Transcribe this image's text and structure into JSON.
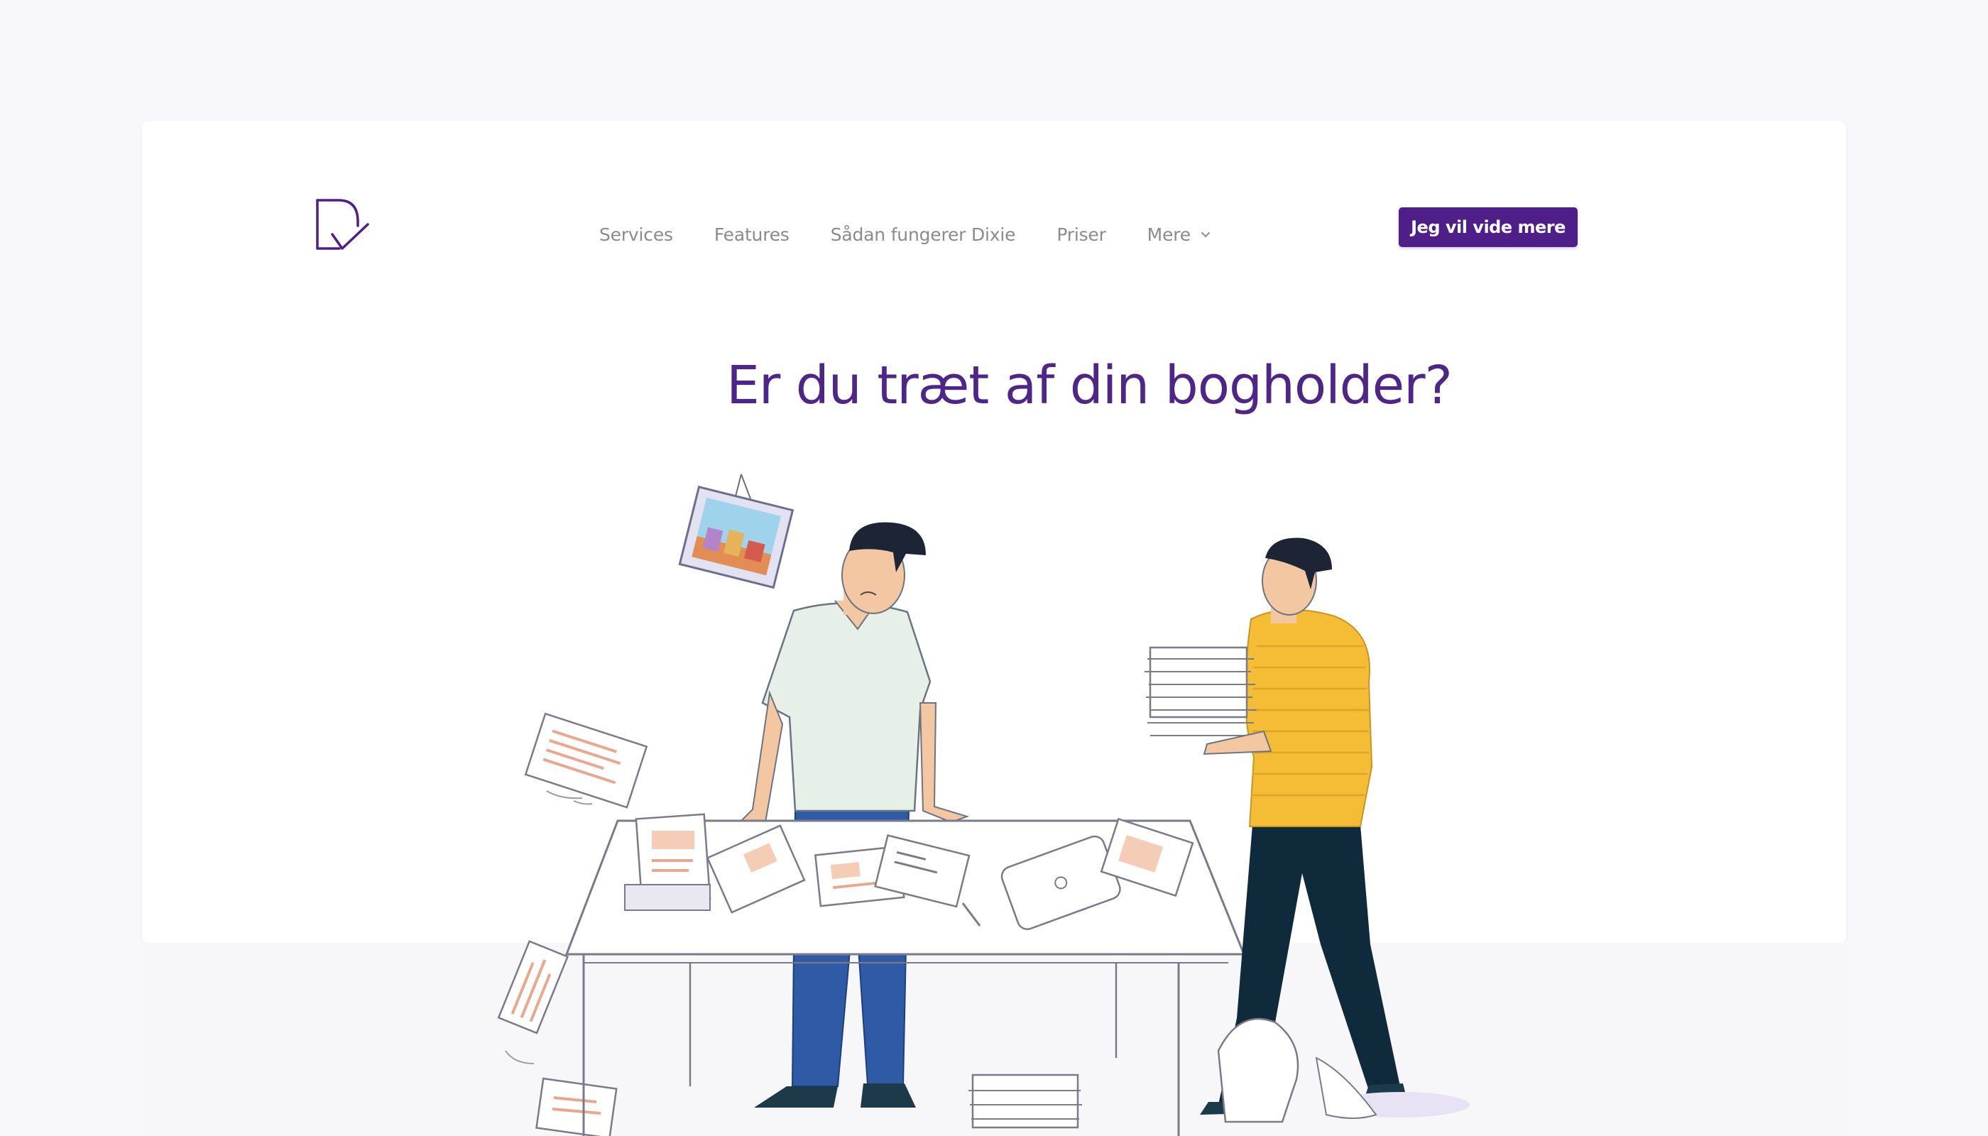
{
  "nav": {
    "items": [
      {
        "label": "Services"
      },
      {
        "label": "Features"
      },
      {
        "label": "Sådan fungerer Dixie"
      },
      {
        "label": "Priser"
      },
      {
        "label": "Mere"
      }
    ]
  },
  "cta": {
    "label": "Jeg vil vide mere"
  },
  "hero": {
    "title": "Er du træt af din bogholder?"
  },
  "colors": {
    "brand_purple": "#4e1f88",
    "headline_purple": "#4d2688",
    "nav_text": "#8a8a94",
    "shirt_yellow": "#f4bd35",
    "shirt_mint": "#e6efe8",
    "pants_navy": "#0f2a3b",
    "jeans_blue": "#2f5aa6"
  },
  "icons": {
    "logo": "dixie-logo-check-icon",
    "dropdown": "chevron-down-icon"
  }
}
